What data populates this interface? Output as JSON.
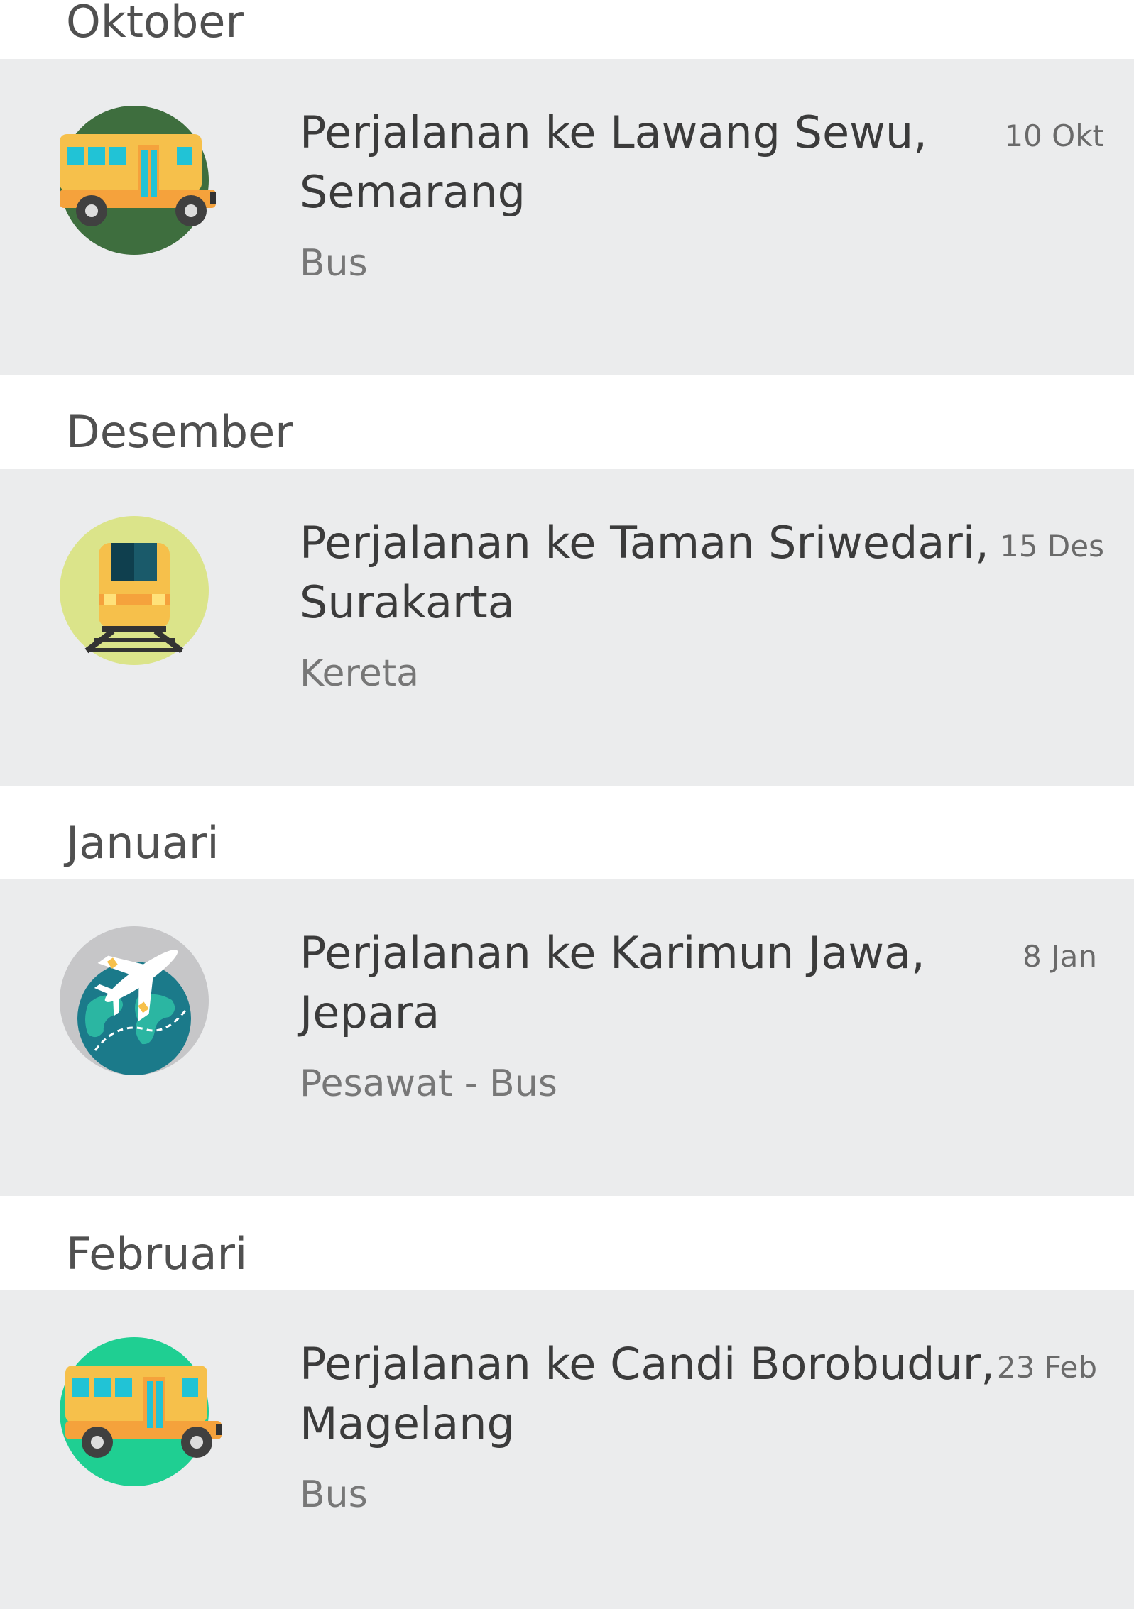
{
  "sections": [
    {
      "month": "Oktober",
      "trip": {
        "title_line1": "Perjalanan ke Lawang Sewu,",
        "title_line2": "Semarang",
        "transport": "Bus",
        "date": "10 Okt",
        "icon": "bus-icon",
        "icon_bg": "#3e6e3e"
      }
    },
    {
      "month": "Desember",
      "trip": {
        "title_line1": "Perjalanan ke Taman Sriwedari,",
        "title_line2": "Surakarta",
        "transport": "Kereta",
        "date": "15 Des",
        "icon": "train-icon",
        "icon_bg": "#dbe48a"
      }
    },
    {
      "month": "Januari",
      "trip": {
        "title_line1": "Perjalanan ke Karimun Jawa,",
        "title_line2": "Jepara",
        "transport": "Pesawat - Bus",
        "date": "8 Jan",
        "icon": "plane-globe-icon",
        "icon_bg": "#c6c6c8"
      }
    },
    {
      "month": "Februari",
      "trip": {
        "title_line1": "Perjalanan ke Candi Borobudur,",
        "title_line2": "Magelang",
        "transport": "Bus",
        "date": "23 Feb",
        "icon": "bus-icon",
        "icon_bg": "#1fcf92"
      }
    }
  ]
}
